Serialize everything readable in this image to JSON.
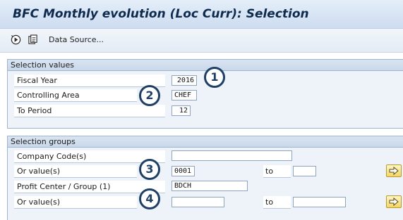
{
  "window": {
    "title": "BFC Monthly evolution (Loc Curr): Selection"
  },
  "toolbar": {
    "execute_icon": "execute-icon",
    "variant_icon": "get-variant-icon",
    "data_source_label": "Data Source..."
  },
  "selection_values": {
    "header": "Selection values",
    "fiscal_year_label": "Fiscal Year",
    "fiscal_year_value": "2016",
    "controlling_area_label": "Controlling Area",
    "controlling_area_value": "CHEF",
    "to_period_label": "To Period",
    "to_period_value": "12"
  },
  "selection_groups": {
    "header": "Selection groups",
    "company_code_label": "Company Code(s)",
    "company_code_value": "",
    "or_values_1_label": "Or value(s)",
    "or_values_1_from": "0001",
    "or_values_1_to_label": "to",
    "or_values_1_to": "",
    "profit_center_label": "Profit Center / Group  (1)",
    "profit_center_value": "BDCH",
    "or_values_2_label": "Or value(s)",
    "or_values_2_from": "",
    "or_values_2_to_label": "to",
    "or_values_2_to": ""
  },
  "callouts": [
    "1",
    "2",
    "3",
    "4"
  ],
  "colors": {
    "callout": "#1f3f66",
    "title": "#0e2a4d",
    "arrow_button": "#f2d664"
  }
}
